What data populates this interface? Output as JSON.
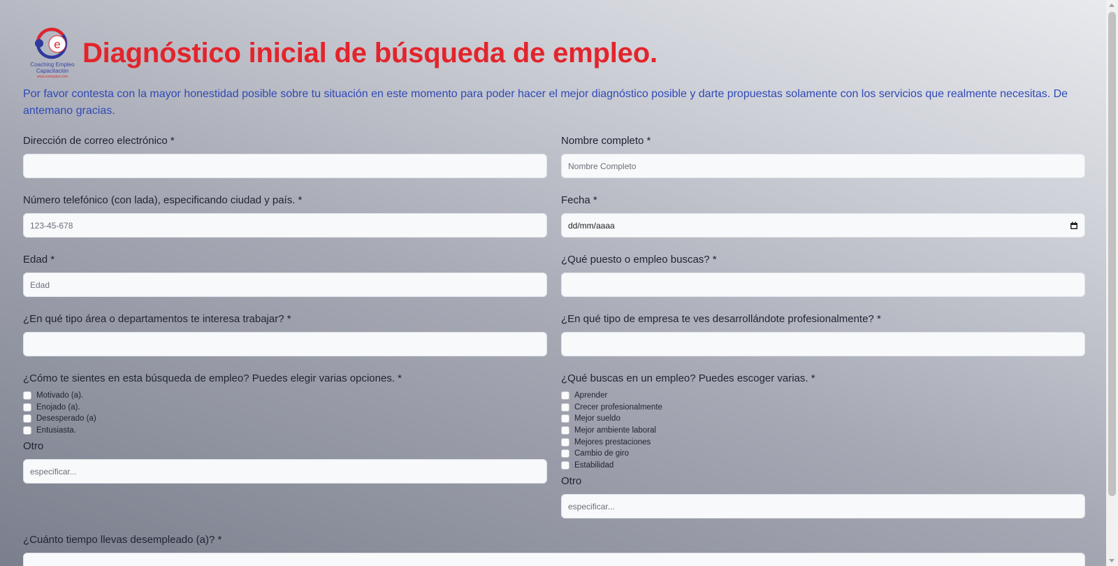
{
  "header": {
    "title": "Diagnóstico inicial de búsqueda de empleo.",
    "logo_text_line1": "Coaching Empleo",
    "logo_text_line2": "Capacitación",
    "logo_url": "www.coempleo.com",
    "logo_letter": "e"
  },
  "intro": "Por favor contesta con la mayor honestidad posible sobre tu situación en este momento para poder hacer el mejor diagnóstico posible y darte propuestas solamente con los servicios que realmente necesitas. De antemano gracias.",
  "fields": {
    "email": {
      "label": "Dirección de correo electrónico *",
      "placeholder": ""
    },
    "name": {
      "label": "Nombre completo *",
      "placeholder": "Nombre Completo"
    },
    "phone": {
      "label": "Número telefónico (con lada), especificando ciudad y país. *",
      "placeholder": "123-45-678"
    },
    "date": {
      "label": "Fecha *",
      "placeholder": "dd/mm/aaaa"
    },
    "age": {
      "label": "Edad *",
      "placeholder": "Edad"
    },
    "position": {
      "label": "¿Qué puesto o empleo buscas? *",
      "placeholder": ""
    },
    "area": {
      "label": "¿En qué tipo área o departamentos te interesa trabajar? *",
      "placeholder": ""
    },
    "company": {
      "label": "¿En qué tipo de empresa te ves desarrollándote profesionalmente? *",
      "placeholder": ""
    },
    "unemployed": {
      "label": "¿Cuánto tiempo llevas desempleado (a)? *"
    }
  },
  "feelings": {
    "label": "¿Cómo te sientes en esta búsqueda de empleo? Puedes elegir varias opciones. *",
    "options": [
      "Motivado (a).",
      "Enojado (a).",
      "Desesperado (a)",
      "Entusiasta."
    ],
    "other_label": "Otro",
    "other_placeholder": "especificar..."
  },
  "seeking": {
    "label": "¿Qué buscas en un empleo? Puedes escoger varias. *",
    "options": [
      "Aprender",
      "Crecer profesionalmente",
      "Mejor sueldo",
      "Mejor ambiente laboral",
      "Mejores prestaciones",
      "Cambio de giro",
      "Estabilidad"
    ],
    "other_label": "Otro",
    "other_placeholder": "especificar..."
  },
  "colors": {
    "title": "#e3242b",
    "intro": "#2f49b8",
    "logo_blue": "#2f3a9e",
    "logo_red": "#e3242b"
  },
  "icons": {
    "date_picker": "calendar-icon"
  }
}
